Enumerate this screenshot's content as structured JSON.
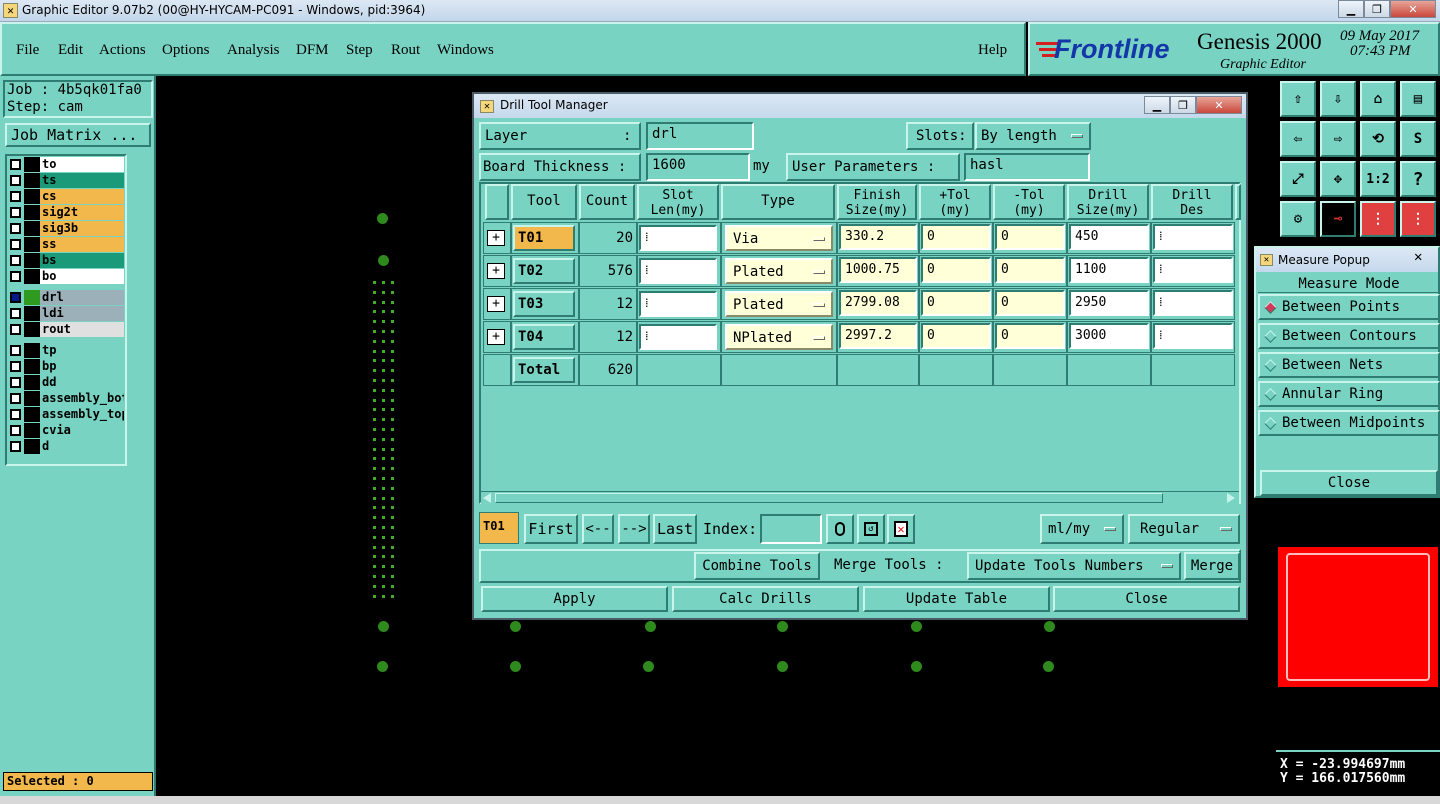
{
  "window_title": "Graphic Editor 9.07b2 (00@HY-HYCAM-PC091 - Windows, pid:3964)",
  "menu": [
    "File",
    "Edit",
    "Actions",
    "Options",
    "Analysis",
    "DFM",
    "Step",
    "Rout",
    "Windows"
  ],
  "menu_help": "Help",
  "brand": {
    "logo": "Frontline",
    "product": "Genesis 2000",
    "sub": "Graphic Editor",
    "date": "09 May 2017",
    "time": "07:43 PM"
  },
  "left": {
    "job": "Job : 4b5qk01fa0",
    "step": "Step: cam",
    "job_matrix": "Job Matrix ...",
    "selected": "Selected : 0"
  },
  "layers": [
    {
      "name": "to",
      "color": "#ffffff"
    },
    {
      "name": "ts",
      "color": "#1a9a78"
    },
    {
      "name": "cs",
      "color": "#f2b84b"
    },
    {
      "name": "sig2t",
      "color": "#f2b84b"
    },
    {
      "name": "sig3b",
      "color": "#f2b84b"
    },
    {
      "name": "ss",
      "color": "#f2b84b"
    },
    {
      "name": "bs",
      "color": "#1a9a78"
    },
    {
      "name": "bo",
      "color": "#ffffff"
    },
    {
      "name": "drl",
      "color": "#9bb0b8"
    },
    {
      "name": "ldi",
      "color": "#9bb0b8"
    },
    {
      "name": "rout",
      "color": "#e0e0e0"
    },
    {
      "name": "tp",
      "color": "#79d3c3"
    },
    {
      "name": "bp",
      "color": "#79d3c3"
    },
    {
      "name": "dd",
      "color": "#79d3c3"
    },
    {
      "name": "assembly_bot",
      "color": "#79d3c3"
    },
    {
      "name": "assembly_top",
      "color": "#79d3c3"
    },
    {
      "name": "cvia",
      "color": "#79d3c3"
    },
    {
      "name": "d",
      "color": "#79d3c3"
    }
  ],
  "dialog": {
    "title": "Drill Tool Manager",
    "layer_label": "Layer",
    "layer_colon": ":",
    "layer_value": "drl",
    "slots_label": "Slots:",
    "slots_value": "By length",
    "thickness_label": "Board Thickness :",
    "thickness_value": "1600",
    "thickness_unit": "my",
    "user_params_label": "User Parameters :",
    "user_params_value": "hasl",
    "columns": [
      "Tool",
      "Count",
      "Slot\nLen(my)",
      "Type",
      "Finish\nSize(my)",
      "+Tol\n(my)",
      "-Tol\n(my)",
      "Drill\nSize(my)",
      "Drill\nDes"
    ],
    "rows": [
      {
        "tool": "T01",
        "count": "20",
        "type": "Via",
        "finish": "330.2",
        "ptol": "0",
        "mtol": "0",
        "drill": "450"
      },
      {
        "tool": "T02",
        "count": "576",
        "type": "Plated",
        "finish": "1000.75",
        "ptol": "0",
        "mtol": "0",
        "drill": "1100"
      },
      {
        "tool": "T03",
        "count": "12",
        "type": "Plated",
        "finish": "2799.08",
        "ptol": "0",
        "mtol": "0",
        "drill": "2950"
      },
      {
        "tool": "T04",
        "count": "12",
        "type": "NPlated",
        "finish": "2997.2",
        "ptol": "0",
        "mtol": "0",
        "drill": "3000"
      }
    ],
    "total_label": "Total",
    "total_value": "620",
    "current_tool": "T01",
    "nav": {
      "first": "First",
      "prev": "<--",
      "next": "-->",
      "last": "Last",
      "index": "Index:"
    },
    "units": "ml/my",
    "mode": "Regular",
    "combine": "Combine Tools",
    "merge_label": "Merge Tools :",
    "merge_option": "Update Tools Numbers",
    "merge": "Merge",
    "apply": "Apply",
    "calc": "Calc Drills",
    "update": "Update Table",
    "close": "Close"
  },
  "measure": {
    "title": "Measure Popup",
    "mode_label": "Measure Mode",
    "options": [
      "Between Points",
      "Between Contours",
      "Between Nets",
      "Annular Ring",
      "Between Midpoints"
    ],
    "selected_index": 0,
    "close": "Close"
  },
  "coords": {
    "x": "X = -23.994697mm",
    "y": "Y = 166.017560mm"
  },
  "toolbar_labels": {
    "one_two": "1:2",
    "help": "?"
  },
  "colors": {
    "panel": "#79d3c3",
    "highlight": "#f2b84b",
    "canvas": "#000000",
    "pad": "#2e8a1d",
    "preview": "#ff0000"
  }
}
